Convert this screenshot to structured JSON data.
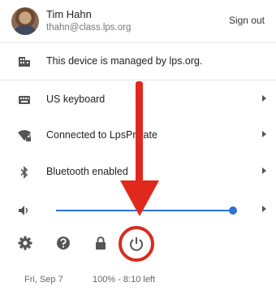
{
  "user": {
    "name": "Tim Hahn",
    "email": "thahn@class.lps.org",
    "signout_label": "Sign out"
  },
  "rows": [
    {
      "label": "This device is managed by lps.org.",
      "icon": "building-icon"
    },
    {
      "label": "US keyboard",
      "icon": "keyboard-icon"
    },
    {
      "label": "Connected to LpsPrivate",
      "icon": "wifi-lock-icon"
    },
    {
      "label": "Bluetooth enabled",
      "icon": "bluetooth-icon"
    }
  ],
  "volume": {
    "icon": "speaker-icon",
    "level_fraction": 1.0
  },
  "tools": [
    "settings-icon",
    "help-icon",
    "lock-icon",
    "power-icon"
  ],
  "footer": {
    "date": "Fri, Sep 7",
    "battery": "100% - 8:10 left"
  },
  "colors": {
    "accent": "#2f6fd6",
    "annotation": "#e0281d"
  }
}
